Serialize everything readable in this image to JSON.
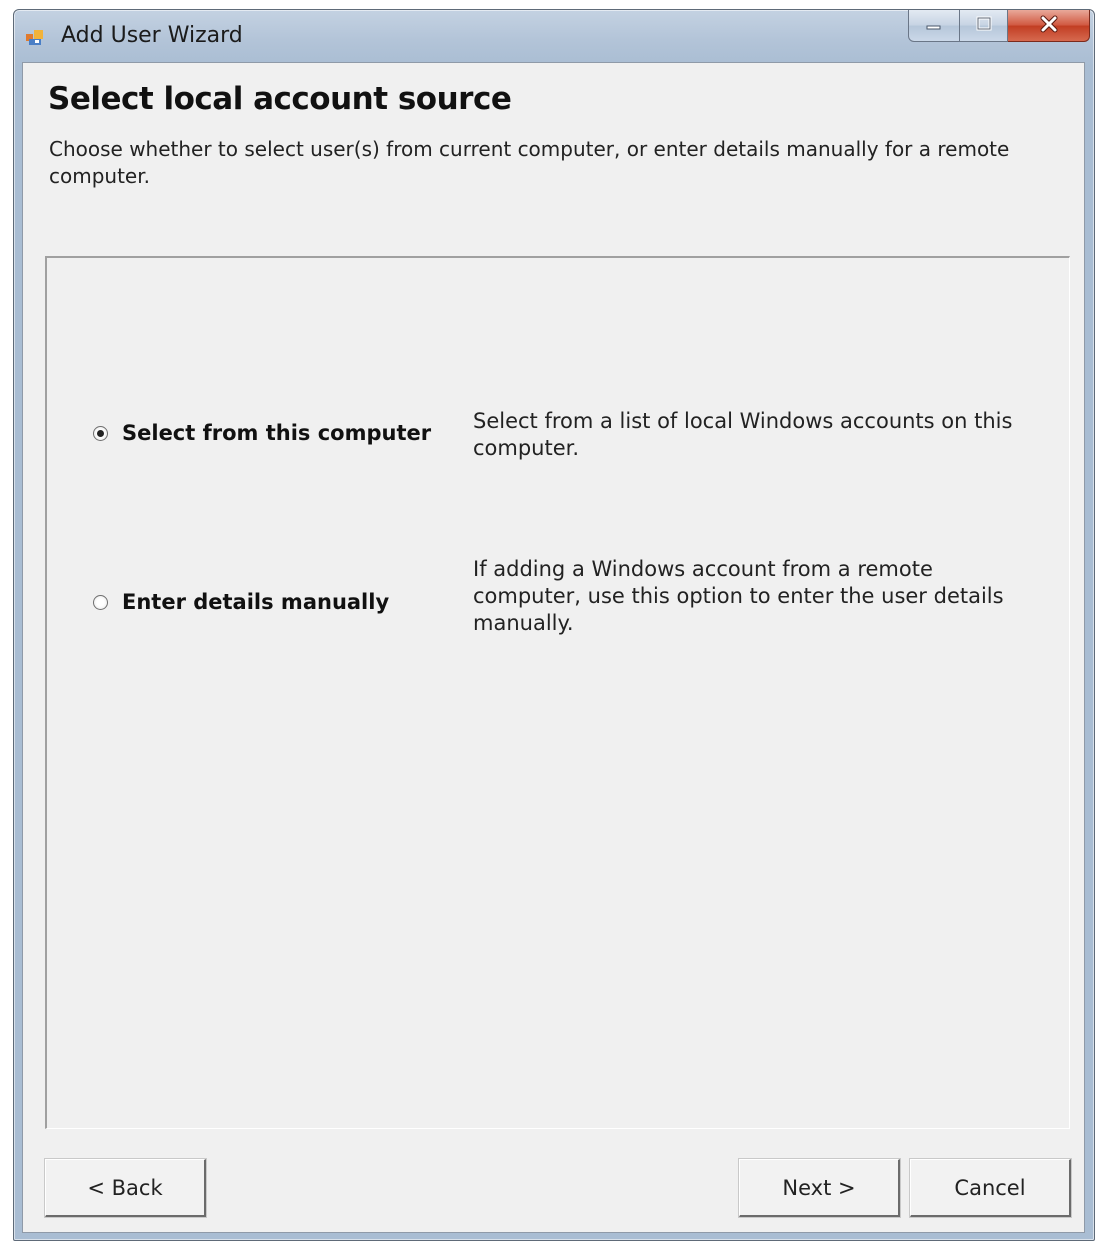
{
  "window": {
    "title": "Add User Wizard",
    "app_icon": "users-app-icon",
    "controls": {
      "minimize": "minimize-icon",
      "maximize": "maximize-icon",
      "close": "close-icon"
    }
  },
  "header": {
    "title": "Select local account source",
    "subtitle": "Choose whether to select user(s) from current computer, or enter details manually for a remote computer."
  },
  "options": [
    {
      "label": "Select from this computer",
      "description": "Select from a list of local Windows accounts on this computer.",
      "selected": true
    },
    {
      "label": "Enter details manually",
      "description": "If adding a Windows account from a remote computer, use this option to enter the user details manually.",
      "selected": false
    }
  ],
  "buttons": {
    "back": "< Back",
    "next": "Next >",
    "cancel": "Cancel"
  },
  "colors": {
    "title_bar": "#b3c4d8",
    "close_button": "#c13d22",
    "dialog_background": "#f0f0f0"
  }
}
